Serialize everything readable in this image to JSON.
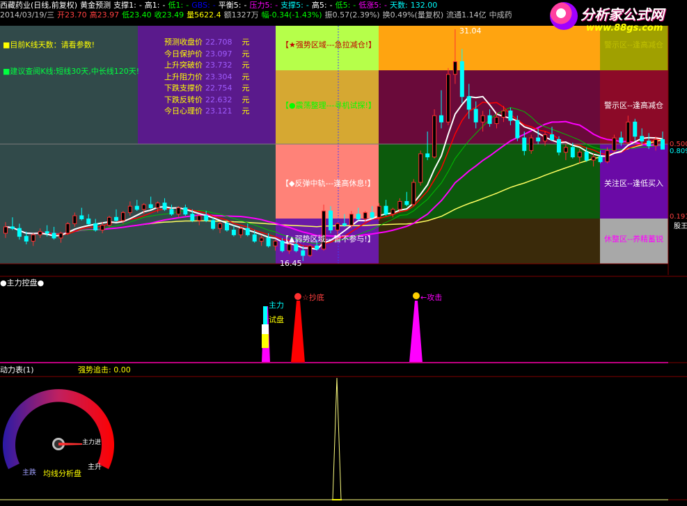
{
  "header": {
    "row1": [
      {
        "text": "西藏药业(日线,前复权)",
        "color": "#ffffff"
      },
      {
        "text": "黄金预测",
        "color": "#ffffff"
      },
      {
        "text": "支撑1:",
        "color": "#ffffff"
      },
      {
        "text": "-",
        "color": "#ffffff"
      },
      {
        "text": "高1:",
        "color": "#ffffff"
      },
      {
        "text": "-",
        "color": "#ffffff"
      },
      {
        "text": "低1:",
        "color": "#00ff00"
      },
      {
        "text": "-",
        "color": "#00ff00"
      },
      {
        "text": "GBS:",
        "color": "#0000ff"
      },
      {
        "text": "-",
        "color": "#0000ff"
      },
      {
        "text": "平衡5:",
        "color": "#ffffff"
      },
      {
        "text": "-",
        "color": "#ffffff"
      },
      {
        "text": "压力5:",
        "color": "#ff00ff"
      },
      {
        "text": "-",
        "color": "#ff00ff"
      },
      {
        "text": "支撑5:",
        "color": "#00ffff"
      },
      {
        "text": "-",
        "color": "#00ffff"
      },
      {
        "text": "高5:",
        "color": "#ffffff"
      },
      {
        "text": "-",
        "color": "#ffffff"
      },
      {
        "text": "低5:",
        "color": "#00ff00"
      },
      {
        "text": "-",
        "color": "#00ff00"
      },
      {
        "text": "低涨5:",
        "color": "#ff00ff"
      },
      {
        "text": "-",
        "color": "#ff00ff"
      },
      {
        "text": "天数:",
        "color": "#00ffff"
      },
      {
        "text": "132.00",
        "color": "#00ffff"
      }
    ],
    "row2": [
      {
        "text": "2014/03/19/三",
        "color": "#c0c0c0"
      },
      {
        "text": "开23.70",
        "color": "#ff4040"
      },
      {
        "text": "高23.97",
        "color": "#ff4040"
      },
      {
        "text": "低23.40",
        "color": "#00ff00"
      },
      {
        "text": "收23.49",
        "color": "#00ff00"
      },
      {
        "text": "量5622.4",
        "color": "#ffff00"
      },
      {
        "text": "额1327万",
        "color": "#c0c0c0"
      },
      {
        "text": "幅-0.34(-1.43%)",
        "color": "#00ff00"
      },
      {
        "text": "振0.57(2.39%)",
        "color": "#c0c0c0"
      },
      {
        "text": "换0.49%(量复权)",
        "color": "#c0c0c0"
      },
      {
        "text": "流通1.14亿",
        "color": "#c0c0c0"
      },
      {
        "text": "中成药",
        "color": "#c0c0c0"
      }
    ]
  },
  "logo": {
    "brand": "分析家公式网",
    "url": "www.88gs.com"
  },
  "info": {
    "line1": "■目前K线天数：请看参数!",
    "line2": "■建议查阅K线:短线30天,中长线120天!"
  },
  "predictions": [
    {
      "label": "预测收盘价",
      "value": "22.708",
      "unit": "元"
    },
    {
      "label": "今日保护价",
      "value": "23.097",
      "unit": "元"
    },
    {
      "label": "上升突破价",
      "value": "23.732",
      "unit": "元"
    },
    {
      "label": "上升阻力价",
      "value": "23.304",
      "unit": "元"
    },
    {
      "label": "下跌支撑价",
      "value": "22.754",
      "unit": "元"
    },
    {
      "label": "下跌反转价",
      "value": "22.632",
      "unit": "元"
    },
    {
      "label": "今日心理价",
      "value": "23.121",
      "unit": "元"
    }
  ],
  "zones": {
    "z1": "【★强势区域---急拉减仓!】",
    "z2": "【●震荡整理---寻机试探!】",
    "z3": "【◆反弹中轨---逢高休息!】",
    "z4": "【▲弱势区域---暂不参与!】",
    "right1": "警示区--逢高减仓",
    "right2": "关注区--逢低买入",
    "right3": "休整区--养精蓄锐",
    "right_top": "警示区--逢高减仓"
  },
  "price_labels": {
    "high": "31.04",
    "low": "16.45",
    "r1": "0.500",
    "r2": "0.191",
    "r3": "股王",
    "r4": "0.809"
  },
  "panel2": {
    "title": "●主力控盘●",
    "tag1a": "主力",
    "tag1b": "试盘",
    "tag2": "☆抄底",
    "tag3": "←攻击"
  },
  "panel3": {
    "title": "动力表(1)",
    "sub": "强势追击: 0.00",
    "gauge_label": "均线分析盘",
    "gauge_left": "主跌",
    "gauge_right": "主升",
    "gauge_needle": "主力进"
  },
  "colors": {
    "up": "#ff3030",
    "down": "#00ffff",
    "ma_white": "#ffffff",
    "ma_magenta": "#ff00ff",
    "ma_yellow": "#ffff60",
    "ma_green": "#00c000",
    "ma_red": "#ff0000"
  },
  "chart_data": {
    "type": "candlestick",
    "price_range": [
      16.45,
      31.04
    ],
    "candles": [
      [
        18.2,
        18.9,
        17.9,
        18.6
      ],
      [
        18.6,
        19.2,
        18.4,
        18.5
      ],
      [
        18.5,
        18.8,
        17.8,
        18.0
      ],
      [
        18.0,
        18.3,
        17.5,
        17.7
      ],
      [
        17.7,
        18.2,
        17.4,
        18.1
      ],
      [
        18.1,
        18.5,
        17.9,
        18.3
      ],
      [
        18.3,
        18.7,
        18.0,
        18.2
      ],
      [
        18.2,
        18.6,
        17.8,
        17.9
      ],
      [
        17.9,
        18.3,
        17.6,
        18.2
      ],
      [
        18.2,
        18.9,
        18.1,
        18.8
      ],
      [
        18.8,
        19.5,
        18.6,
        19.3
      ],
      [
        19.3,
        19.8,
        19.0,
        19.1
      ],
      [
        19.1,
        19.4,
        18.7,
        18.8
      ],
      [
        18.8,
        19.1,
        18.3,
        18.4
      ],
      [
        18.4,
        18.9,
        18.2,
        18.7
      ],
      [
        18.7,
        19.3,
        18.6,
        19.2
      ],
      [
        19.2,
        19.7,
        18.9,
        19.0
      ],
      [
        19.0,
        19.6,
        18.8,
        19.5
      ],
      [
        19.5,
        20.2,
        19.3,
        19.9
      ],
      [
        19.9,
        20.3,
        19.6,
        19.7
      ],
      [
        19.7,
        20.1,
        19.4,
        20.0
      ],
      [
        20.0,
        20.5,
        19.7,
        19.8
      ],
      [
        19.8,
        20.2,
        19.5,
        20.1
      ],
      [
        20.1,
        20.4,
        19.6,
        19.7
      ],
      [
        19.7,
        20.0,
        19.3,
        19.4
      ],
      [
        19.4,
        19.9,
        19.2,
        19.8
      ],
      [
        19.8,
        20.0,
        19.3,
        19.4
      ],
      [
        19.4,
        19.7,
        18.9,
        19.0
      ],
      [
        19.0,
        19.4,
        18.7,
        19.3
      ],
      [
        19.3,
        19.6,
        18.9,
        19.0
      ],
      [
        19.0,
        19.2,
        18.4,
        18.5
      ],
      [
        18.5,
        18.9,
        18.2,
        18.8
      ],
      [
        18.8,
        19.0,
        18.3,
        18.4
      ],
      [
        18.4,
        18.7,
        18.0,
        18.1
      ],
      [
        18.1,
        18.6,
        17.9,
        18.5
      ],
      [
        18.5,
        18.8,
        18.0,
        18.1
      ],
      [
        18.1,
        18.4,
        17.6,
        17.7
      ],
      [
        17.7,
        18.1,
        17.4,
        17.9
      ],
      [
        17.9,
        18.2,
        17.3,
        17.4
      ],
      [
        17.4,
        17.8,
        17.1,
        17.7
      ],
      [
        17.7,
        17.9,
        17.0,
        17.1
      ],
      [
        17.1,
        17.6,
        16.9,
        17.5
      ],
      [
        17.5,
        17.8,
        17.0,
        17.1
      ],
      [
        17.1,
        17.4,
        16.45,
        16.8
      ],
      [
        16.8,
        17.5,
        16.7,
        17.4
      ],
      [
        17.4,
        17.8,
        17.1,
        17.2
      ],
      [
        17.2,
        20.0,
        17.1,
        19.6
      ],
      [
        19.6,
        19.9,
        18.2,
        18.4
      ],
      [
        18.4,
        18.9,
        18.1,
        18.8
      ],
      [
        18.8,
        19.4,
        18.6,
        18.7
      ],
      [
        18.7,
        19.6,
        18.5,
        19.4
      ],
      [
        19.4,
        19.8,
        19.0,
        19.1
      ],
      [
        19.1,
        19.6,
        18.9,
        19.5
      ],
      [
        19.5,
        19.9,
        19.1,
        19.2
      ],
      [
        19.2,
        20.1,
        19.0,
        19.9
      ],
      [
        19.9,
        20.3,
        19.3,
        19.4
      ],
      [
        19.4,
        19.8,
        19.2,
        19.7
      ],
      [
        19.7,
        20.4,
        19.5,
        20.2
      ],
      [
        20.2,
        20.8,
        19.9,
        20.0
      ],
      [
        20.0,
        21.6,
        19.9,
        21.4
      ],
      [
        21.4,
        23.4,
        21.2,
        23.2
      ],
      [
        23.2,
        24.6,
        22.8,
        23.0
      ],
      [
        23.0,
        26.0,
        22.9,
        25.6
      ],
      [
        25.6,
        27.2,
        24.8,
        25.2
      ],
      [
        25.2,
        28.6,
        25.0,
        28.2
      ],
      [
        28.2,
        31.04,
        27.6,
        29.0
      ],
      [
        29.0,
        29.8,
        26.4,
        26.8
      ],
      [
        26.8,
        27.6,
        25.4,
        26.0
      ],
      [
        26.0,
        26.5,
        24.8,
        25.2
      ],
      [
        25.2,
        25.9,
        24.6,
        25.6
      ],
      [
        25.6,
        26.0,
        24.9,
        25.1
      ],
      [
        25.1,
        25.8,
        24.8,
        25.5
      ],
      [
        25.5,
        26.2,
        25.2,
        25.9
      ],
      [
        25.9,
        26.1,
        25.0,
        25.3
      ],
      [
        25.3,
        25.6,
        24.0,
        24.2
      ],
      [
        24.2,
        24.6,
        23.1,
        23.4
      ],
      [
        23.4,
        24.4,
        23.2,
        24.2
      ],
      [
        24.2,
        24.8,
        23.8,
        24.0
      ],
      [
        24.0,
        24.6,
        23.7,
        24.4
      ],
      [
        24.4,
        24.9,
        24.0,
        24.1
      ],
      [
        24.1,
        24.3,
        23.1,
        23.3
      ],
      [
        23.3,
        23.8,
        22.8,
        23.6
      ],
      [
        23.6,
        23.9,
        22.9,
        23.0
      ],
      [
        23.0,
        23.5,
        22.6,
        23.3
      ],
      [
        23.3,
        23.6,
        22.7,
        22.8
      ],
      [
        22.8,
        23.2,
        22.4,
        23.0
      ],
      [
        23.0,
        23.4,
        22.6,
        22.7
      ],
      [
        22.7,
        23.6,
        22.6,
        23.4
      ],
      [
        23.4,
        24.4,
        23.3,
        24.2
      ],
      [
        24.2,
        24.6,
        23.7,
        23.9
      ],
      [
        23.9,
        25.6,
        23.8,
        25.2
      ],
      [
        25.2,
        25.4,
        24.0,
        24.3
      ],
      [
        24.3,
        24.8,
        23.8,
        24.0
      ],
      [
        24.0,
        24.5,
        23.5,
        23.7
      ],
      [
        23.7,
        24.3,
        23.4,
        24.1
      ],
      [
        24.1,
        24.6,
        23.7,
        23.49
      ]
    ]
  }
}
